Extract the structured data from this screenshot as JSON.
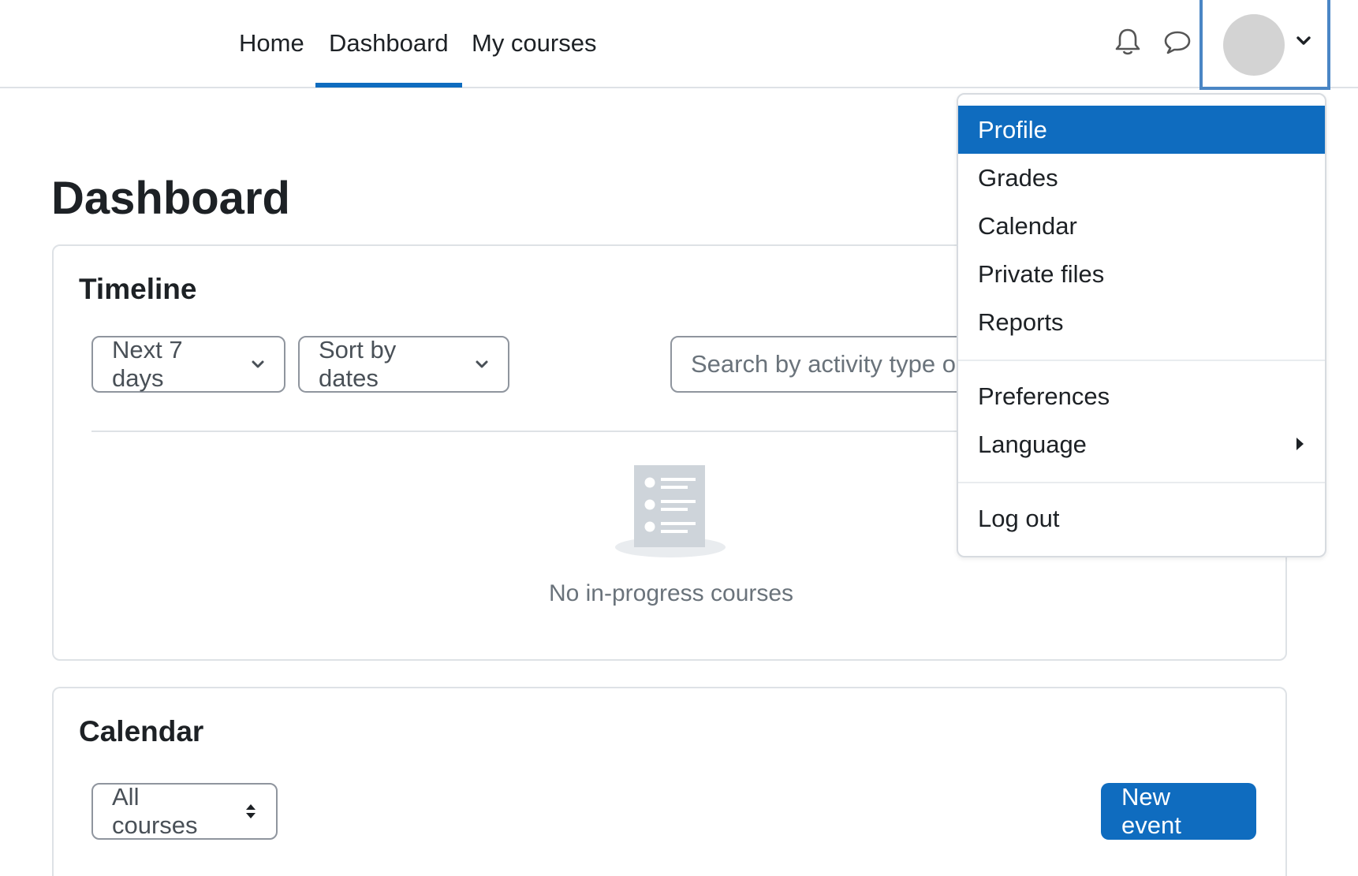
{
  "navbar": {
    "items": [
      {
        "label": "Home",
        "active": false
      },
      {
        "label": "Dashboard",
        "active": true
      },
      {
        "label": "My courses",
        "active": false
      }
    ],
    "icons": [
      "bell-icon",
      "chat-bubble-icon"
    ],
    "user_menu_toggle": {
      "avatar": "avatar-placeholder",
      "caret": "chevron-down-icon"
    }
  },
  "page": {
    "title": "Dashboard"
  },
  "timeline": {
    "title": "Timeline",
    "day_filter": "Next 7 days",
    "sort": "Sort by dates",
    "search_placeholder": "Search by activity type or name",
    "empty_message": "No in-progress courses"
  },
  "calendar": {
    "title": "Calendar",
    "course_select": "All courses",
    "new_event_label": "New event"
  },
  "user_menu": {
    "items": [
      {
        "label": "Profile",
        "active": true
      },
      {
        "label": "Grades",
        "active": false
      },
      {
        "label": "Calendar",
        "active": false
      },
      {
        "label": "Private files",
        "active": false
      },
      {
        "label": "Reports",
        "active": false
      }
    ],
    "preferences_label": "Preferences",
    "language_label": "Language",
    "logout_label": "Log out"
  },
  "colors": {
    "accent": "#0f6cbf",
    "text": "#1d2125",
    "muted": "#6a737b",
    "border": "#dee2e6",
    "focus": "#4a86c5"
  }
}
